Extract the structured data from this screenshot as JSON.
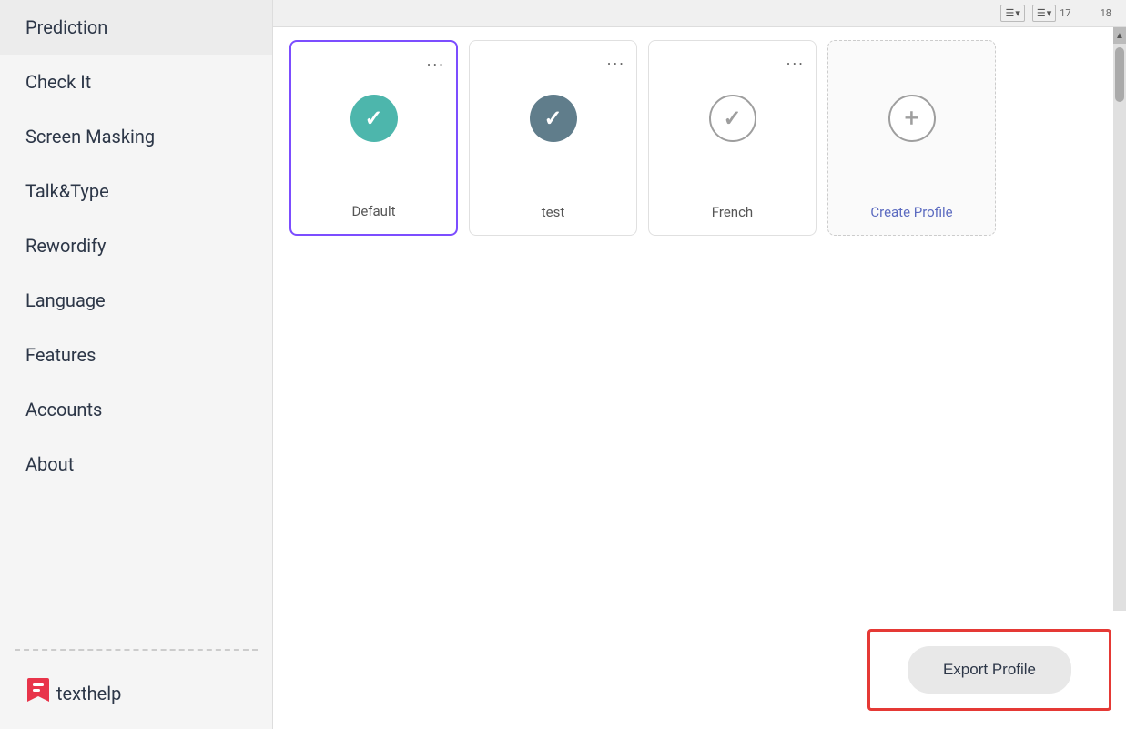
{
  "sidebar": {
    "items": [
      {
        "label": "Prediction",
        "id": "prediction"
      },
      {
        "label": "Check It",
        "id": "check-it"
      },
      {
        "label": "Screen Masking",
        "id": "screen-masking"
      },
      {
        "label": "Talk&Type",
        "id": "talk-type"
      },
      {
        "label": "Rewordify",
        "id": "rewordify"
      },
      {
        "label": "Language",
        "id": "language"
      },
      {
        "label": "Features",
        "id": "features"
      },
      {
        "label": "Accounts",
        "id": "accounts"
      },
      {
        "label": "About",
        "id": "about"
      }
    ],
    "logo_text": "texthelp"
  },
  "toolbar": {
    "ruler_17": "17",
    "ruler_18": "18"
  },
  "profiles": [
    {
      "id": "default",
      "label": "Default",
      "icon_type": "filled-teal",
      "active": true,
      "has_menu": true
    },
    {
      "id": "test",
      "label": "test",
      "icon_type": "filled-gray",
      "active": false,
      "has_menu": true
    },
    {
      "id": "french",
      "label": "French",
      "icon_type": "outline",
      "active": false,
      "has_menu": true
    },
    {
      "id": "create",
      "label": "Create Profile",
      "icon_type": "plus",
      "active": false,
      "has_menu": false
    }
  ],
  "export": {
    "button_label": "Export Profile"
  },
  "menu_dots": "..."
}
